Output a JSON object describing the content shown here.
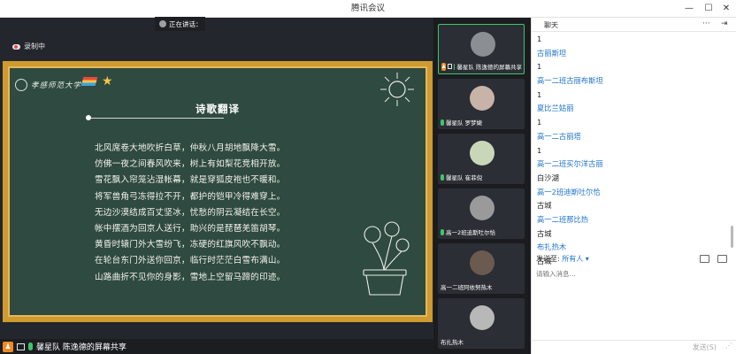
{
  "window": {
    "title": "腾讯会议",
    "controls": {
      "minimize": "—",
      "maximize": "☐",
      "close": "✕"
    }
  },
  "share": {
    "recording_label": "录制中",
    "presenter_label": "馨星队 陈逸德的屏幕共享"
  },
  "slide": {
    "school_name": "孝感师范大学",
    "title": "诗歌翻译",
    "lines": [
      "北风席卷大地吹折白草，仲秋八月胡地飘降大雪。",
      "仿佛一夜之间春风吹来，树上有如梨花竞相开放。",
      "雪花飘入帘笼沾湿帐幕，就是穿狐皮袍也不暖和。",
      "将军兽角弓冻得拉不开，都护的铠甲冷得难穿上。",
      "无边沙漠结成百丈坚冰，忧愁的阴云凝结在长空。",
      "帐中摆酒为回京人送行，助兴的是琵琶羌笛胡琴。",
      "黄昏时辕门外大雪纷飞，冻硬的红旗风吹不飘动。",
      "在轮台东门外送你回京，临行时茫茫白雪布满山。",
      "山路曲折不见你的身影，雪地上空留马蹄的印迹。"
    ]
  },
  "videos": [
    {
      "name": "馨星队 陈逸德的屏幕共享",
      "active": true,
      "avatar_color": "#8b8f94"
    },
    {
      "name": "馨星队 罗梦婕",
      "active": false,
      "avatar_color": "#c7b3a8"
    },
    {
      "name": "馨星队 崔菲倪",
      "active": false,
      "avatar_color": "#c9d7b8"
    },
    {
      "name": "高一2班迪斯吐尔恰",
      "active": false,
      "avatar_color": "#9a9a9a"
    },
    {
      "name": "高一二班阿依努热木",
      "active": false,
      "avatar_color": "#6b5a4f"
    },
    {
      "name": "布扎热木",
      "active": false,
      "avatar_color": "#b8b8b8"
    }
  ],
  "chat": {
    "title": "聊天",
    "more": "···",
    "collapse": "⇥",
    "speaking": "正在讲话：",
    "messages": [
      {
        "type": "text",
        "content": "1"
      },
      {
        "type": "sender",
        "content": "古丽斯坦"
      },
      {
        "type": "text",
        "content": "1"
      },
      {
        "type": "sender",
        "content": "高一二班古丽布斯坦"
      },
      {
        "type": "text",
        "content": "1"
      },
      {
        "type": "sender",
        "content": "夏比兰姑丽"
      },
      {
        "type": "text",
        "content": "1"
      },
      {
        "type": "sender",
        "content": "高一二古丽塔"
      },
      {
        "type": "text",
        "content": "1"
      },
      {
        "type": "sender",
        "content": "高一二班买尔洋古丽"
      },
      {
        "type": "text",
        "content": "白沙湖"
      },
      {
        "type": "sender",
        "content": "高一2班迪斯吐尔恰"
      },
      {
        "type": "text",
        "content": "古城"
      },
      {
        "type": "sender",
        "content": "高一二班那比热"
      },
      {
        "type": "text",
        "content": "古城"
      },
      {
        "type": "sender",
        "content": "布扎热木"
      },
      {
        "type": "text",
        "content": "古城"
      }
    ],
    "send_to_label": "发送至:",
    "send_to_value": "所有人",
    "input_placeholder": "请输入消息...",
    "send_button": "发送(S)"
  }
}
